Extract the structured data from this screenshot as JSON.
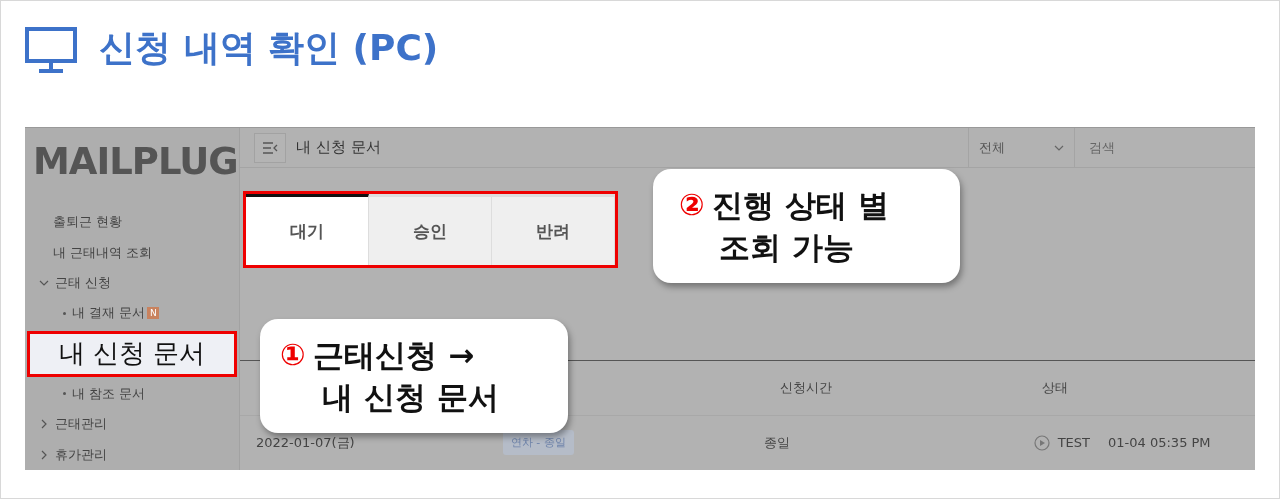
{
  "header": {
    "title": "신청 내역 확인 (PC)"
  },
  "app": {
    "logo": "MAILPLUG",
    "sidebar": [
      {
        "label": "출퇴근 현황",
        "kind": "link"
      },
      {
        "label": "내 근태내역 조회",
        "kind": "link"
      },
      {
        "label": "근태 신청",
        "kind": "group",
        "expanded": true,
        "children": [
          {
            "label": "내 결재 문서",
            "badge": "N"
          },
          {
            "label": "내 신청 문서",
            "highlighted": true
          },
          {
            "label": "내 참조 문서"
          }
        ]
      },
      {
        "label": "근태관리",
        "kind": "group",
        "expanded": false
      },
      {
        "label": "휴가관리",
        "kind": "group",
        "expanded": false
      }
    ],
    "page_title": "내 신청 문서",
    "filter": {
      "value": "전체"
    },
    "search": {
      "placeholder": "검색"
    },
    "tabs": [
      {
        "label": "대기",
        "selected": true
      },
      {
        "label": "승인",
        "selected": false
      },
      {
        "label": "반려",
        "selected": false
      }
    ],
    "table": {
      "columns": [
        "신청시간",
        "상태"
      ],
      "rows": [
        {
          "date": "2022-01-07(금)",
          "type": "연차 - 종일",
          "time": "종일",
          "status": "TEST",
          "status_time": "01-04 05:35 PM"
        }
      ]
    }
  },
  "callouts": [
    {
      "number": "①",
      "lines": [
        "근태신청 →",
        "내 신청 문서"
      ]
    },
    {
      "number": "②",
      "lines": [
        "진행 상태 별",
        "조회 가능"
      ]
    }
  ]
}
